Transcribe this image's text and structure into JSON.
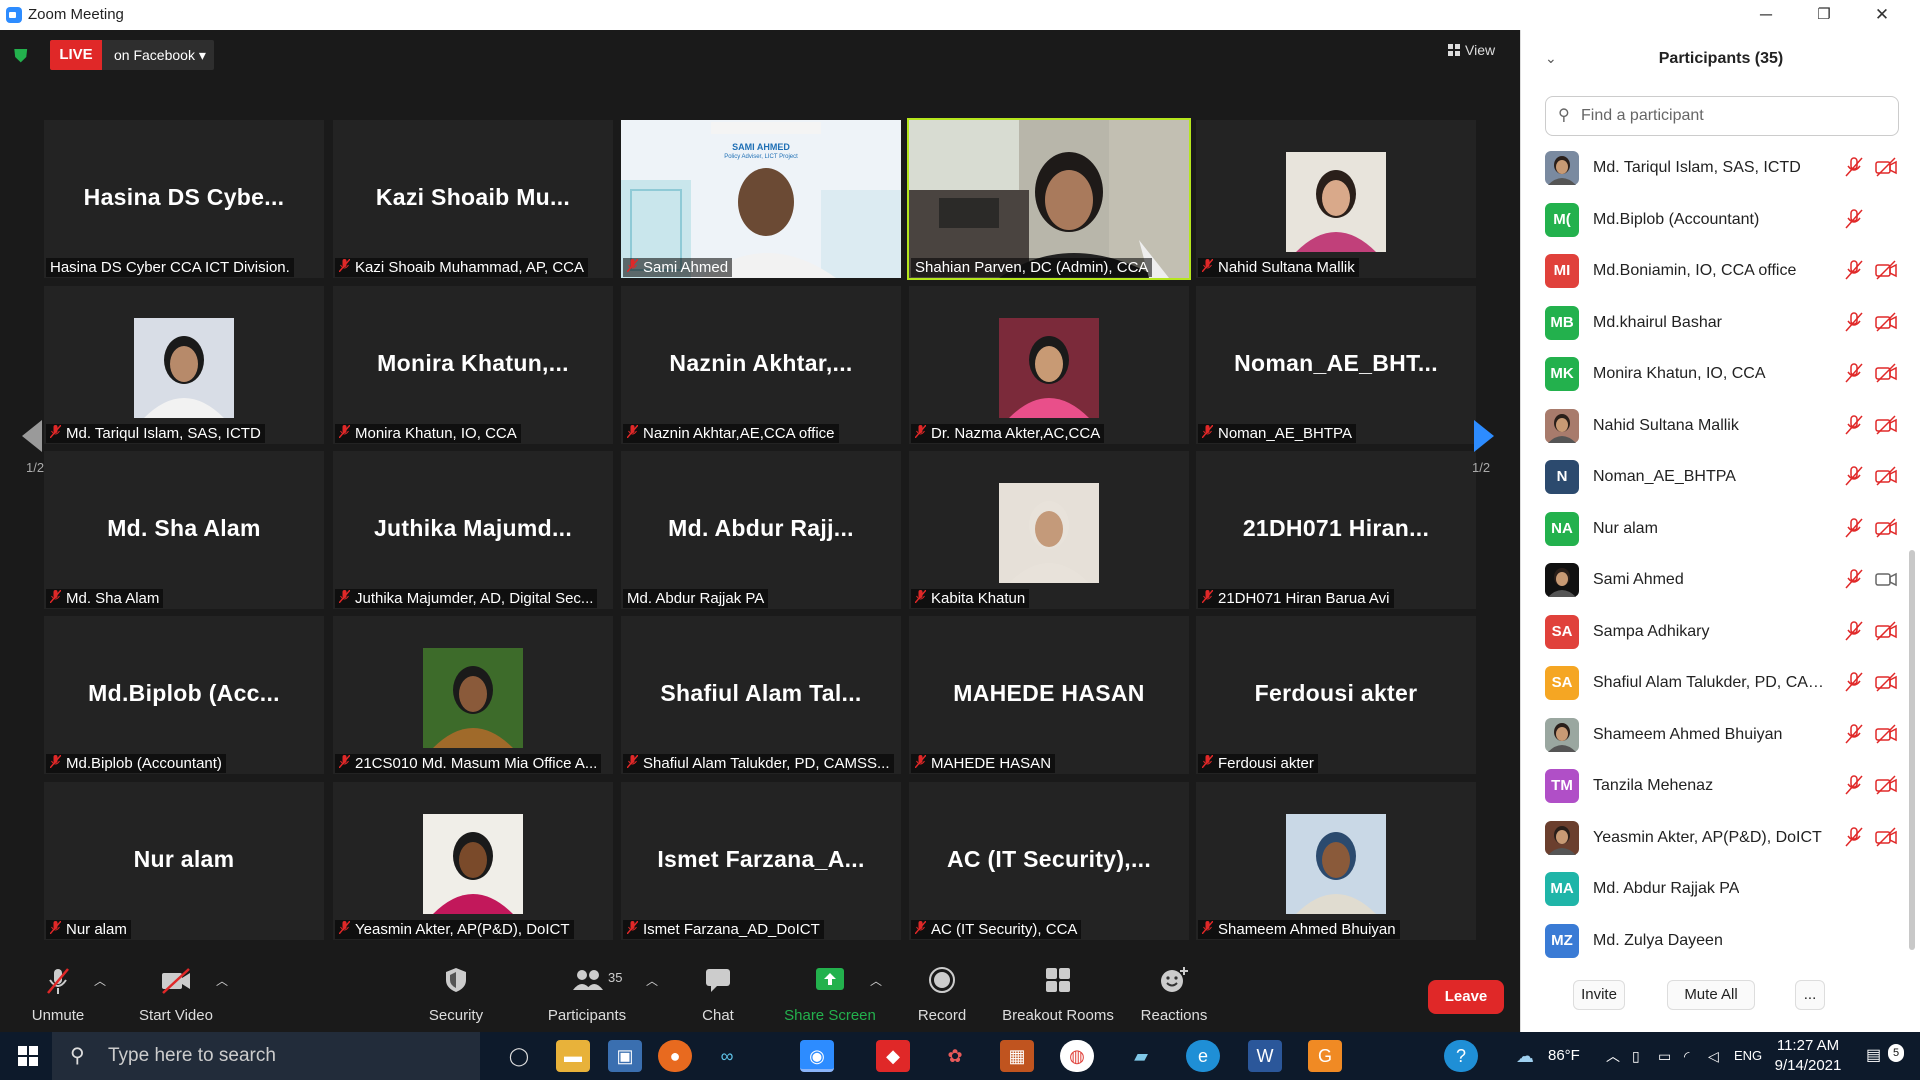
{
  "window": {
    "title": "Zoom Meeting",
    "minimize": "─",
    "restore": "❐",
    "close": "✕"
  },
  "livebar": {
    "live_label": "LIVE",
    "destination": "on Facebook",
    "caret": "▾"
  },
  "view_button": "View",
  "page_indicator": "1/2",
  "tiles": [
    {
      "big": "Hasina DS Cybe...",
      "label": "Hasina DS Cyber CCA ICT Division.",
      "muted": false,
      "kind": "name"
    },
    {
      "big": "Kazi Shoaib Mu...",
      "label": "Kazi Shoaib Muhammad, AP, CCA",
      "muted": true,
      "kind": "name"
    },
    {
      "big": "",
      "label": "Sami Ahmed",
      "muted": true,
      "kind": "video-slide"
    },
    {
      "big": "",
      "label": "Shahian Parven, DC (Admin), CCA",
      "muted": false,
      "kind": "video-room",
      "active": true
    },
    {
      "big": "",
      "label": "Nahid Sultana Mallik",
      "muted": true,
      "kind": "photo-pink"
    },
    {
      "big": "",
      "label": "Md. Tariqul Islam, SAS, ICTD",
      "muted": true,
      "kind": "photo-blue"
    },
    {
      "big": "Monira  Khatun,...",
      "label": "Monira Khatun, IO, CCA",
      "muted": true,
      "kind": "name"
    },
    {
      "big": "Naznin  Akhtar,...",
      "label": "Naznin Akhtar,AE,CCA office",
      "muted": true,
      "kind": "name"
    },
    {
      "big": "",
      "label": "Dr. Nazma Akter,AC,CCA",
      "muted": true,
      "kind": "photo-green"
    },
    {
      "big": "Noman_AE_BHT...",
      "label": "Noman_AE_BHTPA",
      "muted": true,
      "kind": "name"
    },
    {
      "big": "Md. Sha Alam",
      "label": "Md. Sha Alam",
      "muted": true,
      "kind": "name"
    },
    {
      "big": "Juthika  Majumd...",
      "label": "Juthika Majumder, AD,  Digital Sec...",
      "muted": true,
      "kind": "name"
    },
    {
      "big": "Md.  Abdur  Rajj...",
      "label": "Md. Abdur Rajjak PA",
      "muted": false,
      "kind": "name"
    },
    {
      "big": "",
      "label": "Kabita Khatun",
      "muted": true,
      "kind": "photo-hijab"
    },
    {
      "big": "21DH071  Hiran...",
      "label": "21DH071 Hiran Barua Avi",
      "muted": true,
      "kind": "name"
    },
    {
      "big": "Md.Biplob  (Acc...",
      "label": "Md.Biplob (Accountant)",
      "muted": true,
      "kind": "name"
    },
    {
      "big": "",
      "label": "21CS010 Md. Masum Mia Office A...",
      "muted": true,
      "kind": "photo-forest"
    },
    {
      "big": "Shafiul  Alam  Tal...",
      "label": "Shafiul Alam Talukder, PD, CAMSS...",
      "muted": true,
      "kind": "name"
    },
    {
      "big": "MAHEDE HASAN",
      "label": "MAHEDE HASAN",
      "muted": true,
      "kind": "name"
    },
    {
      "big": "Ferdousi akter",
      "label": "Ferdousi akter",
      "muted": true,
      "kind": "name"
    },
    {
      "big": "Nur alam",
      "label": "Nur alam",
      "muted": true,
      "kind": "name"
    },
    {
      "big": "",
      "label": "Yeasmin Akter, AP(P&D), DoICT",
      "muted": true,
      "kind": "photo-woman"
    },
    {
      "big": "Ismet  Farzana_A...",
      "label": "Ismet Farzana_AD_DoICT",
      "muted": true,
      "kind": "name"
    },
    {
      "big": "AC  (IT  Security),...",
      "label": "AC (IT Security), CCA",
      "muted": true,
      "kind": "name"
    },
    {
      "big": "",
      "label": "Shameem Ahmed Bhuiyan",
      "muted": true,
      "kind": "photo-taj"
    }
  ],
  "slide_text": {
    "name": "SAMI AHMED",
    "sub": "Policy Adviser, LICT Project"
  },
  "toolbar": {
    "unmute": "Unmute",
    "start_video": "Start Video",
    "security": "Security",
    "participants": "Participants",
    "participants_count": "35",
    "chat": "Chat",
    "share_screen": "Share Screen",
    "record": "Record",
    "breakout_rooms": "Breakout Rooms",
    "reactions": "Reactions",
    "leave": "Leave"
  },
  "panel": {
    "title": "Participants (35)",
    "search_placeholder": "Find a participant",
    "participants": [
      {
        "initials": "",
        "name": "Md. Tariqul Islam, SAS, ICTD",
        "color": "#7a8aa0",
        "photo": true,
        "cam": false,
        "mic_muted": true
      },
      {
        "initials": "M(",
        "name": "Md.Biplob (Accountant)",
        "color": "#23b14d",
        "photo": false,
        "cam": null,
        "mic_muted": true
      },
      {
        "initials": "MI",
        "name": "Md.Boniamin, IO, CCA office",
        "color": "#e0413b",
        "photo": false,
        "cam": false,
        "mic_muted": true
      },
      {
        "initials": "MB",
        "name": "Md.khairul Bashar",
        "color": "#23b14d",
        "photo": false,
        "cam": false,
        "mic_muted": true
      },
      {
        "initials": "MK",
        "name": "Monira Khatun, IO, CCA",
        "color": "#23b14d",
        "photo": false,
        "cam": false,
        "mic_muted": true
      },
      {
        "initials": "",
        "name": "Nahid Sultana Mallik",
        "color": "#a87b6c",
        "photo": true,
        "cam": false,
        "mic_muted": true
      },
      {
        "initials": "N",
        "name": "Noman_AE_BHTPA",
        "color": "#2c4a6e",
        "photo": false,
        "cam": false,
        "mic_muted": true
      },
      {
        "initials": "NA",
        "name": "Nur alam",
        "color": "#23b14d",
        "photo": false,
        "cam": false,
        "mic_muted": true
      },
      {
        "initials": "",
        "name": "Sami Ahmed",
        "color": "#111111",
        "photo": true,
        "cam": true,
        "mic_muted": true
      },
      {
        "initials": "SA",
        "name": "Sampa Adhikary",
        "color": "#e0413b",
        "photo": false,
        "cam": false,
        "mic_muted": true
      },
      {
        "initials": "SA",
        "name": "Shafiul Alam Talukder, PD, CAMSS...",
        "color": "#f5a623",
        "photo": false,
        "cam": false,
        "mic_muted": true
      },
      {
        "initials": "",
        "name": "Shameem Ahmed Bhuiyan",
        "color": "#9aa7a0",
        "photo": true,
        "cam": false,
        "mic_muted": true
      },
      {
        "initials": "TM",
        "name": "Tanzila Mehenaz",
        "color": "#b04fc7",
        "photo": false,
        "cam": false,
        "mic_muted": true
      },
      {
        "initials": "",
        "name": "Yeasmin Akter, AP(P&D), DoICT",
        "color": "#6b3f2e",
        "photo": true,
        "cam": false,
        "mic_muted": true
      },
      {
        "initials": "MA",
        "name": "Md. Abdur Rajjak PA",
        "color": "#1fb5a8",
        "photo": false,
        "cam": null,
        "mic_muted": false
      },
      {
        "initials": "MZ",
        "name": "Md. Zulya Dayeen",
        "color": "#3a7bd5",
        "photo": false,
        "cam": null,
        "mic_muted": false
      }
    ],
    "invite": "Invite",
    "mute_all": "Mute All",
    "more": "..."
  },
  "taskbar": {
    "search_placeholder": "Type here to search",
    "temperature": "86°F",
    "language": "ENG",
    "time": "11:27 AM",
    "date": "9/14/2021",
    "notifications": "5"
  }
}
